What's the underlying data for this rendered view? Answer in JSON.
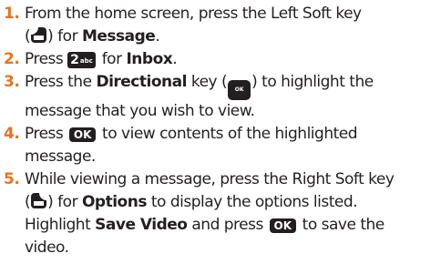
{
  "colors": {
    "step_number": "#e8731f",
    "text": "#231f20",
    "key_background": "#231f20"
  },
  "icons": {
    "left_soft_key": "left-soft-key-icon",
    "right_soft_key": "right-soft-key-icon",
    "number_2_key": "number-2-key-icon",
    "directional_key": "directional-key-icon",
    "ok_key": "ok-key-icon"
  },
  "keys": {
    "two_digit": "2",
    "two_letters": "abc",
    "ok_label": "OK",
    "directional_label": "OK"
  },
  "steps": [
    {
      "number": "1.",
      "line1": "From the home screen, press the Left Soft key",
      "open_paren": "(",
      "close_paren": ") for ",
      "bold": "Message",
      "end": "."
    },
    {
      "number": "2.",
      "press": "Press ",
      "for": " for ",
      "bold": "Inbox",
      "end": "."
    },
    {
      "number": "3.",
      "press": "Press the ",
      "bold": "Directional",
      "key_open": " key (",
      "key_close": ") to highlight the",
      "line2": "message that you wish to view."
    },
    {
      "number": "4.",
      "press": "Press ",
      "after": " to view contents of the highlighted",
      "line2": "message."
    },
    {
      "number": "5.",
      "line1": "While viewing a message, press the Right Soft key",
      "open_paren": "(",
      "close_paren": ") for ",
      "bold1": "Options",
      "after1": " to display the options listed.",
      "highlight": "Highlight ",
      "bold2": "Save Video",
      "and_press": " and press ",
      "after2": " to save the",
      "line4": "video."
    }
  ]
}
